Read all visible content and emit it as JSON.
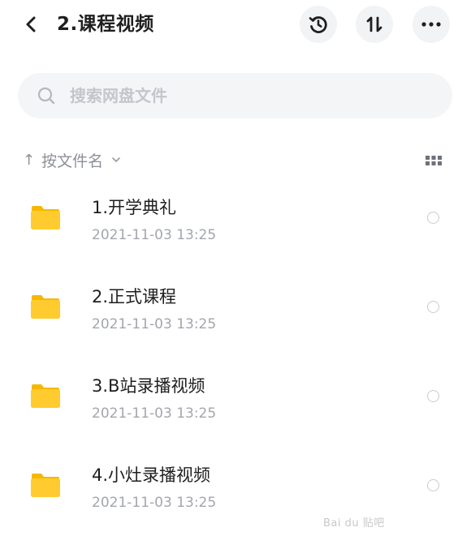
{
  "header": {
    "title": "2.课程视频",
    "back_icon": "chevron-left-icon",
    "history_icon": "history-icon",
    "sort_icon": "sort-arrows-icon",
    "sort_glyph": "1l",
    "more_icon": "more-horizontal-icon"
  },
  "search": {
    "placeholder": "搜索网盘文件",
    "value": "",
    "icon": "search-icon"
  },
  "sort": {
    "arrow": "↑",
    "label": "按文件名",
    "caret": "⌄",
    "view_toggle_icon": "grid-view-icon"
  },
  "files": [
    {
      "name": "1.开学典礼",
      "date": "2021-11-03  13:25",
      "icon": "folder-icon"
    },
    {
      "name": "2.正式课程",
      "date": "2021-11-03  13:25",
      "icon": "folder-icon"
    },
    {
      "name": "3.B站录播视频",
      "date": "2021-11-03  13:25",
      "icon": "folder-icon"
    },
    {
      "name": "4.小灶录播视频",
      "date": "2021-11-03  13:25",
      "icon": "folder-icon"
    }
  ],
  "watermark": "Bai du 贴吧",
  "colors": {
    "folder": "#FFCB2F",
    "folder_tab": "#F5B800",
    "secondary_text": "#A3A6AD",
    "search_bg": "#F4F5F7"
  }
}
